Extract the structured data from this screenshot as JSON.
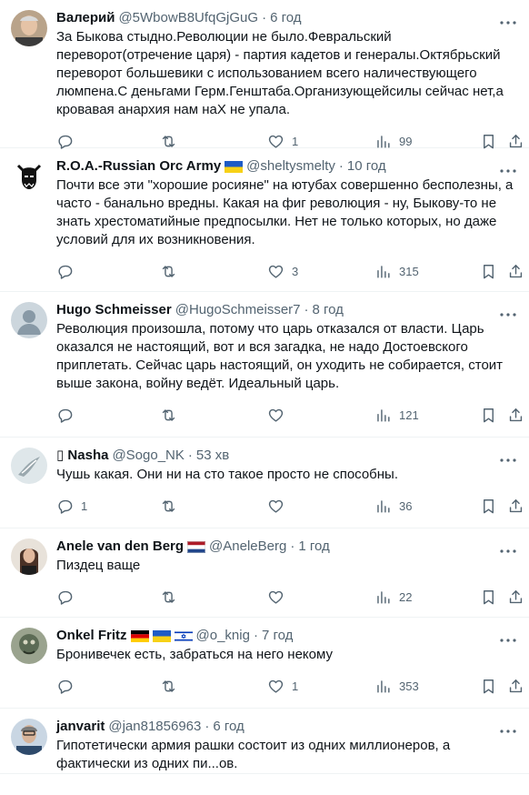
{
  "posts": [
    {
      "name": "Валерий",
      "handle": "@5WbowB8UfqGjGuG",
      "time": "6 год",
      "flags": [],
      "text": "За Быкова стыдно.Революции  не было.Февральский\nпереворот(отречение царя) - партия кадетов и генералы.Октябрьский\nпереворот большевики с использованием всего наличествующего\nлюмпена.С  деньгами Герм.Генштаба.Организующейсилы сейчас нет,а\nкровавая анархия нам наХ не упала.",
      "replies": "",
      "reposts": "",
      "likes": "1",
      "views": "99"
    },
    {
      "name": "R.O.A.-Russian Orc Army",
      "handle": "@sheltysmelty",
      "time": "10 год",
      "flags": [
        "ukraine"
      ],
      "text": "Почти все эти \"хорошие росияне\" на ютубах совершенно бесполезны, а\nчасто - банально вредны. Какая на фиг революция - ну, Быкову-то не\nзнать хрестоматийные предпосылки. Нет не только которых, но даже\nусловий для их возникновения.",
      "replies": "",
      "reposts": "",
      "likes": "3",
      "views": "315"
    },
    {
      "name": "Hugo Schmeisser",
      "handle": "@HugoSchmeisser7",
      "time": "8 год",
      "flags": [],
      "text": "Революция произошла, потому что царь отказался от власти. Царь\nоказался не настоящий, вот и вся загадка, не надо Достоевского\nприплетать. Сейчас царь настоящий, он уходить не собирается, стоит\nвыше закона, войну ведёт. Идеальный царь.",
      "replies": "",
      "reposts": "",
      "likes": "",
      "views": "121"
    },
    {
      "name": "▯ Nasha",
      "handle": "@Sogo_NK",
      "time": "53 хв",
      "flags": [],
      "text": "Чушь какая. Они ни на сто такое просто не способны.",
      "replies": "1",
      "reposts": "",
      "likes": "",
      "views": "36"
    },
    {
      "name": "Anele van den Berg",
      "handle": "@AneleBerg",
      "time": "1 год",
      "flags": [
        "netherlands"
      ],
      "text": "Пиздец ваще",
      "replies": "",
      "reposts": "",
      "likes": "",
      "views": "22"
    },
    {
      "name": "Onkel Fritz",
      "handle": "@o_knig",
      "time": "7 год",
      "flags": [
        "germany",
        "ukraine",
        "israel"
      ],
      "text": "Бронивечек есть, забраться на него некому",
      "replies": "",
      "reposts": "",
      "likes": "1",
      "views": "353"
    },
    {
      "name": "janvarit",
      "handle": "@jan81856963",
      "time": "6 год",
      "flags": [],
      "text": "Гипотетически армия рашки состоит из одних миллионеров, а\nфактически из одних пи...ов.",
      "replies": "",
      "reposts": "",
      "likes": "",
      "views": ""
    }
  ],
  "icons": {
    "reply": "reply-icon",
    "repost": "repost-icon",
    "like": "heart-icon",
    "views": "views-icon",
    "bookmark": "bookmark-icon",
    "share": "share-icon",
    "more": "more-icon"
  },
  "colors": {
    "text": "#0f1419",
    "secondary": "#536471",
    "divider": "#eff3f4"
  }
}
